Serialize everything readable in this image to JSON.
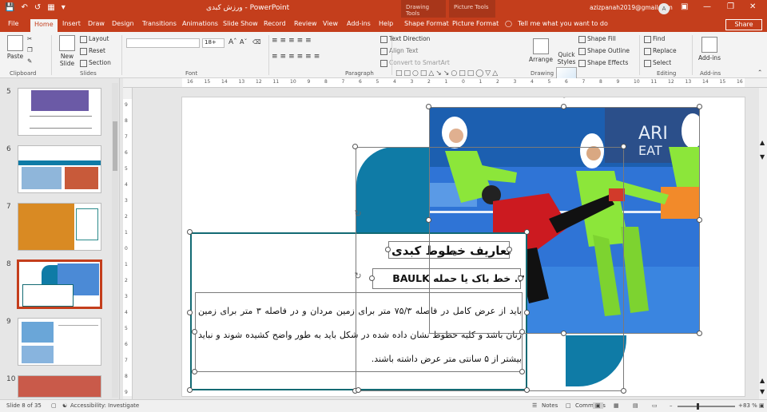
{
  "window": {
    "doc_title": "ورزش کبدی  -  PowerPoint",
    "context_tabs": [
      "Drawing Tools",
      "Picture Tools"
    ],
    "tell_me": "Tell me what you want to do",
    "account": "azizpanah2019@gmail.com",
    "avatar_letter": "A",
    "share": "Share"
  },
  "tabs": [
    "File",
    "Home",
    "Insert",
    "Draw",
    "Design",
    "Transitions",
    "Animations",
    "Slide Show",
    "Record",
    "Review",
    "View",
    "Add-ins",
    "Help",
    "Shape Format",
    "Picture Format"
  ],
  "ribbon": {
    "clipboard": {
      "label": "Clipboard",
      "paste": "Paste"
    },
    "slides": {
      "label": "Slides",
      "new_slide": "New Slide",
      "layout": "Layout",
      "reset": "Reset",
      "section": "Section"
    },
    "font": {
      "label": "Font",
      "font_size": "18+"
    },
    "paragraph": {
      "label": "Paragraph",
      "text_direction": "Text Direction",
      "align_text": "Align Text",
      "smartart": "Convert to SmartArt"
    },
    "drawing": {
      "label": "Drawing",
      "arrange": "Arrange",
      "quick_styles": "Quick Styles",
      "shape_fill": "Shape Fill",
      "shape_outline": "Shape Outline",
      "shape_effects": "Shape Effects"
    },
    "editing": {
      "label": "Editing",
      "find": "Find",
      "replace": "Replace",
      "select": "Select"
    },
    "addins": {
      "label": "Add-ins",
      "btn": "Add-ins"
    }
  },
  "thumbnails": [
    {
      "num": "5",
      "selected": false
    },
    {
      "num": "6",
      "selected": false
    },
    {
      "num": "7",
      "selected": false
    },
    {
      "num": "8",
      "selected": true
    },
    {
      "num": "9",
      "selected": false
    },
    {
      "num": "10",
      "selected": false
    }
  ],
  "hruler_ticks": [
    "16",
    "15",
    "14",
    "13",
    "12",
    "11",
    "10",
    "9",
    "8",
    "7",
    "6",
    "5",
    "4",
    "3",
    "2",
    "1",
    "0",
    "1",
    "2",
    "3",
    "4",
    "5",
    "6",
    "7",
    "8",
    "9",
    "10",
    "11",
    "12",
    "13",
    "14",
    "15",
    "16"
  ],
  "vruler_ticks": [
    "9",
    "8",
    "7",
    "6",
    "5",
    "4",
    "3",
    "2",
    "1",
    "0",
    "1",
    "2",
    "3",
    "4",
    "5",
    "6",
    "7",
    "8",
    "9"
  ],
  "slide": {
    "title": "تعاریف خطوط کبدی",
    "subtitle": "۳. خط باک یا حمله BAULK",
    "body": "باید از عرض کامل در فاصله ۷۵/۳ متر برای زمین مردان و در فاصله ۳ متر برای زمین زنان باشد و کلیه خطوط نشان داده شده در شکل باید به طور واضح کشیده شوند و نباید بیشتر از ۵ سانتی متر عرض داشته باشند."
  },
  "status": {
    "slide_info": "Slide 8 of 35",
    "accessibility": "Accessibility: Investigate",
    "notes": "Notes",
    "comments": "Comments",
    "zoom": "83 %",
    "zoom_fraction": 0.33
  },
  "colors": {
    "accent": "#c43e1c",
    "teal": "#0f7ba6",
    "textbox_border": "#136a73"
  }
}
